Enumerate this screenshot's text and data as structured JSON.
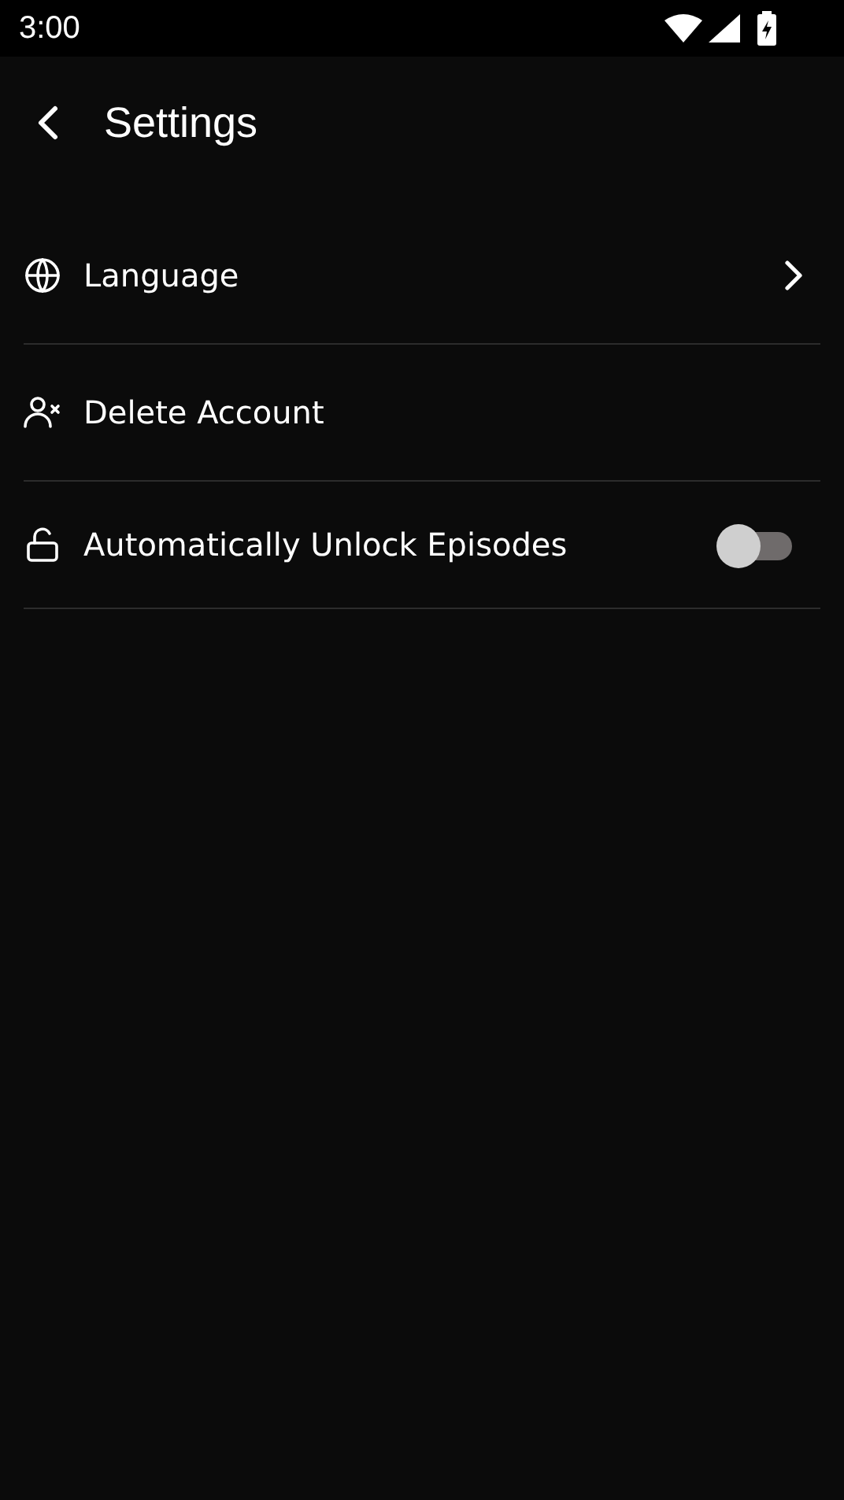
{
  "status_bar": {
    "time": "3:00"
  },
  "header": {
    "title": "Settings"
  },
  "settings": [
    {
      "kind": "link",
      "label": "Language"
    },
    {
      "kind": "action",
      "label": "Delete Account"
    },
    {
      "kind": "toggle",
      "label": "Automatically Unlock Episodes",
      "on": false
    }
  ]
}
